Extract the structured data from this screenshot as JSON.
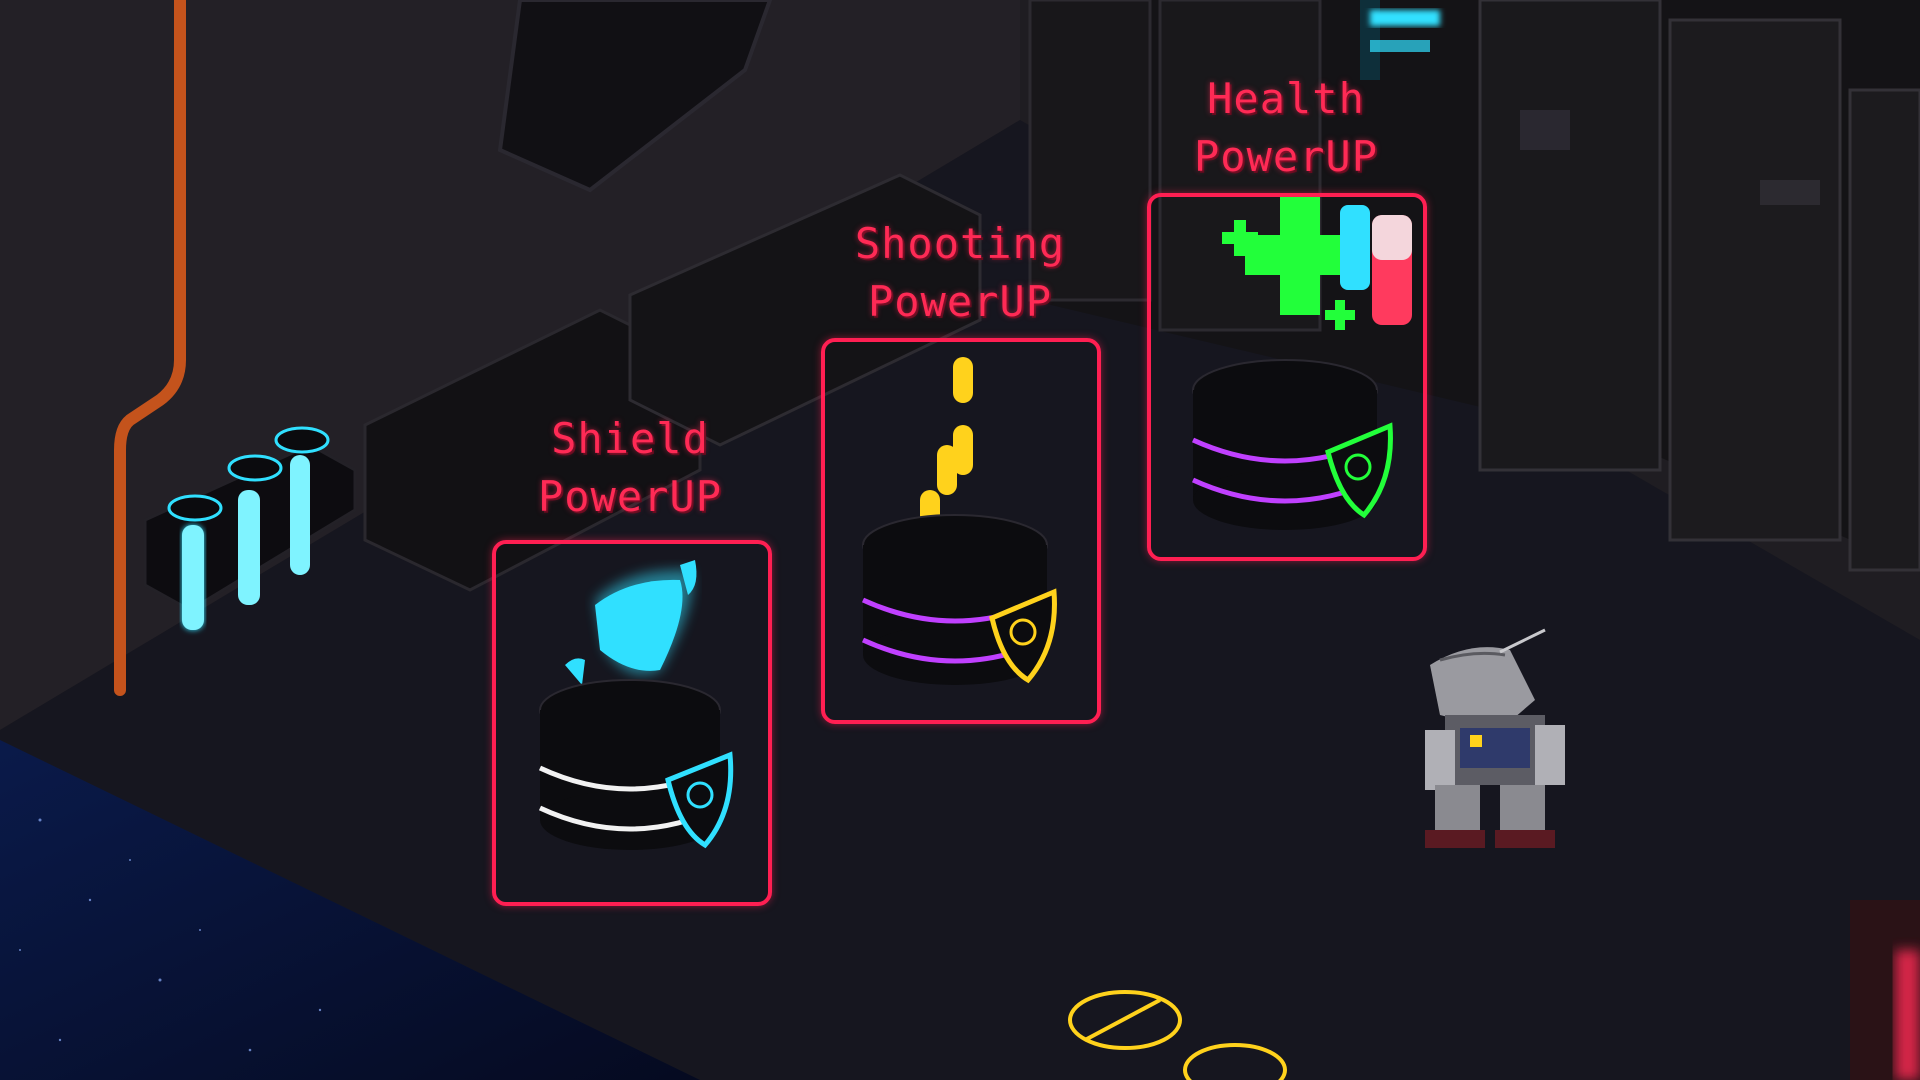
{
  "powerups": [
    {
      "id": "shield",
      "line1": "Shield",
      "line2": "PowerUP",
      "accent": "#30e0ff"
    },
    {
      "id": "shooting",
      "line1": "Shooting",
      "line2": "PowerUP",
      "accent": "#ffd21c"
    },
    {
      "id": "health",
      "line1": "Health",
      "line2": "PowerUP",
      "accent": "#22ff3a"
    }
  ],
  "colors": {
    "label": "#ff2a55",
    "frame": "#ff1f52",
    "ring_purple": "#c040ff",
    "ring_white": "#f2f2f2"
  }
}
